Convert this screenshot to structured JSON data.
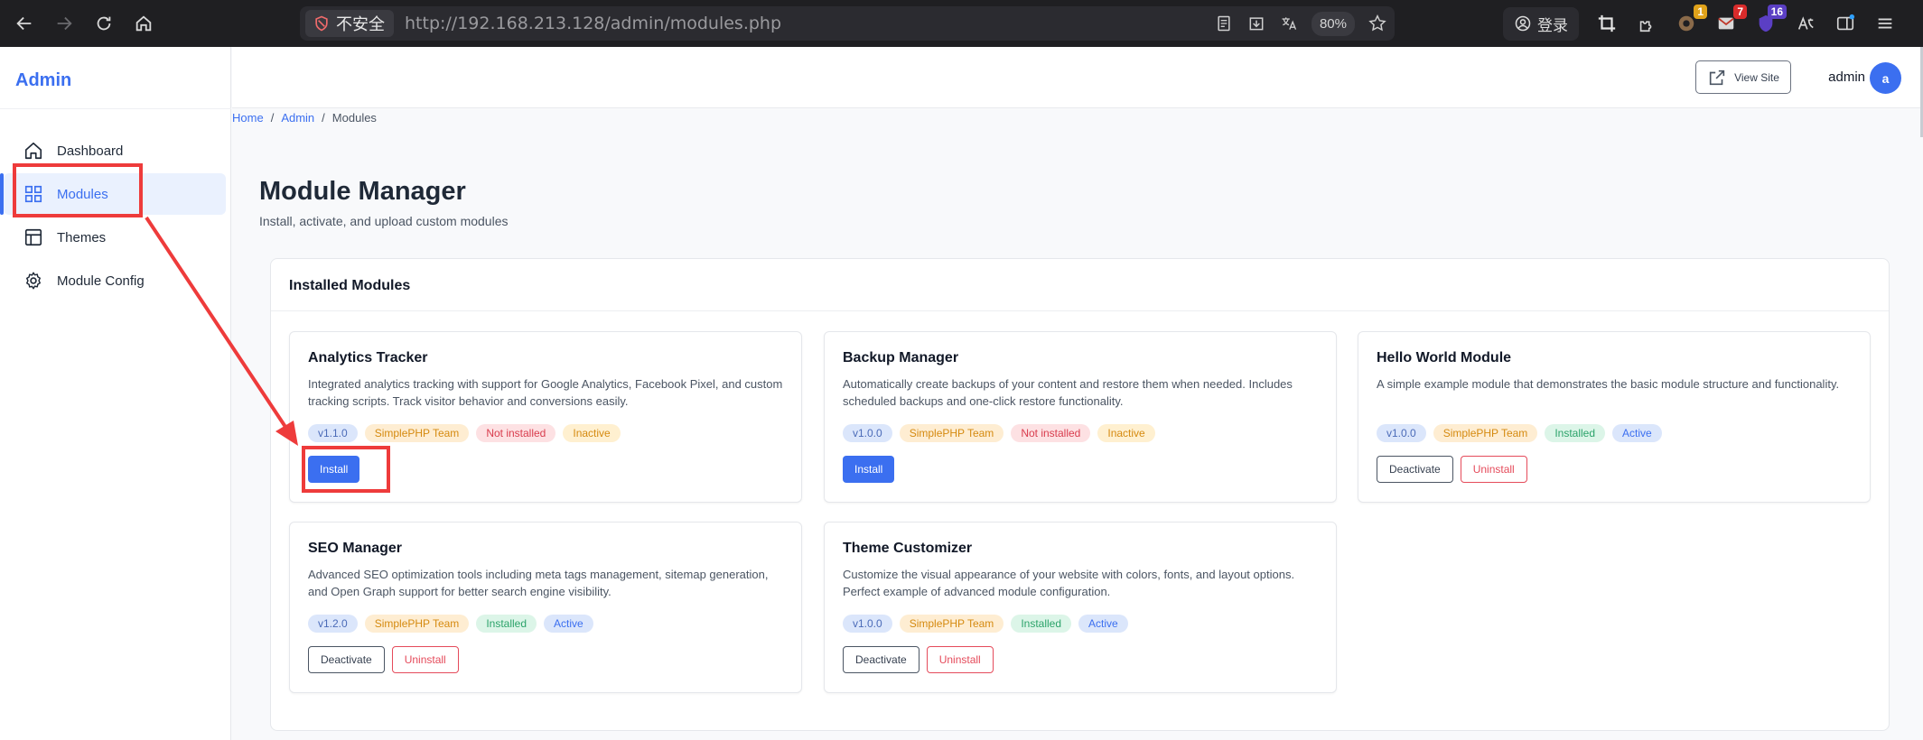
{
  "browser": {
    "security_label": "不安全",
    "url": "http://192.168.213.128/admin/modules.php",
    "zoom": "80%",
    "login_label": "登录",
    "extension_badges": [
      "1",
      "7",
      "16"
    ]
  },
  "sidebar": {
    "brand": "Admin",
    "items": [
      {
        "label": "Dashboard",
        "icon": "home-icon"
      },
      {
        "label": "Modules",
        "icon": "grid-icon"
      },
      {
        "label": "Themes",
        "icon": "layout-icon"
      },
      {
        "label": "Module Config",
        "icon": "gear-icon"
      }
    ],
    "active_index": 1
  },
  "topbar": {
    "view_site_label": "View Site",
    "user_name": "admin",
    "avatar_letter": "a"
  },
  "breadcrumb": [
    "Home",
    "Admin",
    "Modules"
  ],
  "page": {
    "title": "Module Manager",
    "subtitle": "Install, activate, and upload custom modules"
  },
  "panel": {
    "title": "Installed Modules"
  },
  "modules": [
    {
      "name": "Analytics Tracker",
      "description": "Integrated analytics tracking with support for Google Analytics, Facebook Pixel, and custom tracking scripts. Track visitor behavior and conversions easily.",
      "version": "v1.1.0",
      "author": "SimplePHP Team",
      "install_status": "Not installed",
      "active_status": "Inactive",
      "buttons": [
        "Install"
      ]
    },
    {
      "name": "Backup Manager",
      "description": "Automatically create backups of your content and restore them when needed. Includes scheduled backups and one-click restore functionality.",
      "version": "v1.0.0",
      "author": "SimplePHP Team",
      "install_status": "Not installed",
      "active_status": "Inactive",
      "buttons": [
        "Install"
      ]
    },
    {
      "name": "Hello World Module",
      "description": "A simple example module that demonstrates the basic module structure and functionality.",
      "version": "v1.0.0",
      "author": "SimplePHP Team",
      "install_status": "Installed",
      "active_status": "Active",
      "buttons": [
        "Deactivate",
        "Uninstall"
      ]
    },
    {
      "name": "SEO Manager",
      "description": "Advanced SEO optimization tools including meta tags management, sitemap generation, and Open Graph support for better search engine visibility.",
      "version": "v1.2.0",
      "author": "SimplePHP Team",
      "install_status": "Installed",
      "active_status": "Active",
      "buttons": [
        "Deactivate",
        "Uninstall"
      ]
    },
    {
      "name": "Theme Customizer",
      "description": "Customize the visual appearance of your website with colors, fonts, and layout options. Perfect example of advanced module configuration.",
      "version": "v1.0.0",
      "author": "SimplePHP Team",
      "install_status": "Installed",
      "active_status": "Active",
      "buttons": [
        "Deactivate",
        "Uninstall"
      ]
    }
  ],
  "colors": {
    "accent": "#3b6ff0",
    "annotation": "#ee3b3b"
  }
}
